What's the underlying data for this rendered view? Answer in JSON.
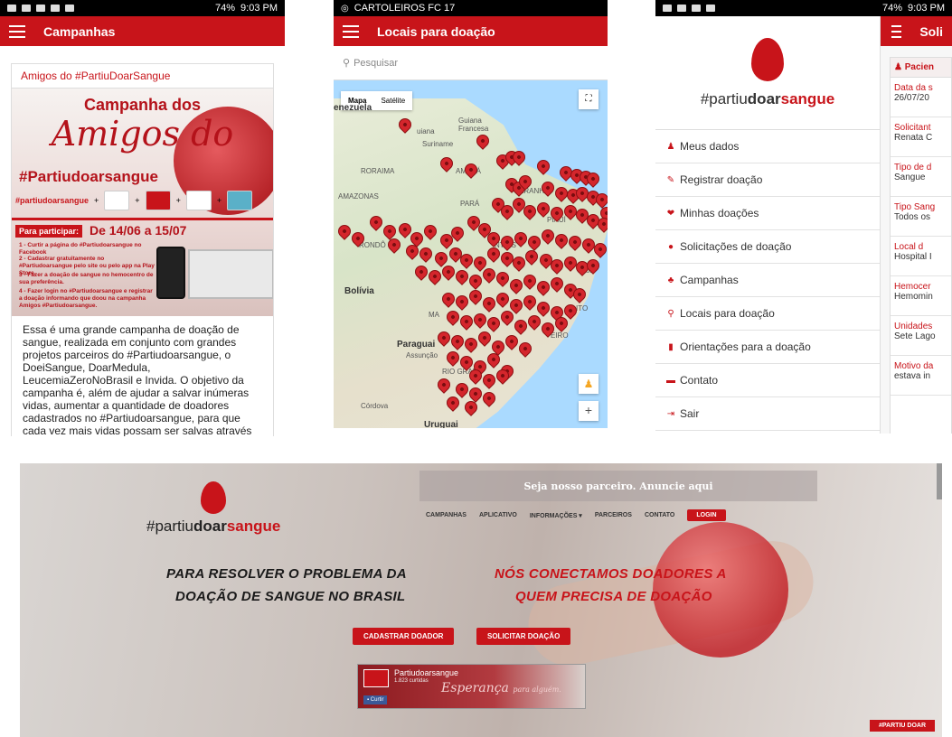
{
  "screen1": {
    "status_time": "9:03 PM",
    "status_battery": "74%",
    "appbar_title": "Campanhas",
    "card_title": "Amigos do #PartiuDoarSangue",
    "poster_line1": "Campanha dos",
    "poster_line2": "Amigos do",
    "poster_line3": "#Partiudoarsangue",
    "poster_brand": "#partiudoarsangue",
    "poster_para": "Para participar:",
    "poster_dates": "De 14/06 a 15/07",
    "poster_steps": [
      "1 - Curtir a página do #Partiudoarsangue no Facebook",
      "2 - Cadastrar gratuitamente no #Partiudoarsangue pelo site ou pelo app na Play Store.",
      "3 - Fazer a doação de sangue no hemocentro de sua preferência.",
      "4 - Fazer login no #Partiudoarsangue e registrar a doação informando que doou na campanha Amigos #Partiudoarsangue."
    ],
    "body_text": "Essa é uma grande campanha de doação de sangue, realizada em conjunto com grandes projetos parceiros do #Partiudoarsangue, o DoeiSangue, DoarMedula, LeucemiaZeroNoBrasil e Invida.  O objetivo da campanha é, além de ajudar a salvar inúmeras vidas, aumentar a quantidade de doadores cadastrados no #Partiudoarsangue, para que cada vez mais vidas possam ser salvas através da plataforma."
  },
  "screen2": {
    "status_text": "CARTOLEIROS FC 17",
    "appbar_title": "Locais para doação",
    "search_placeholder": "Pesquisar",
    "tab_map": "Mapa",
    "tab_sat": "Satélite",
    "labels": {
      "venezuela": "enezuela",
      "guiana": "uiana",
      "guiana_fr": "Guiana Francesa",
      "suriname": "Suriname",
      "roraima": "RORAIMA",
      "amapa": "AMAPÁ",
      "amazonas": "AMAZONAS",
      "para": "PARÁ",
      "maranhao": "ARANH",
      "piaui": "PIAUÍ",
      "rondonia": "RONDÔ",
      "tocantins": "NTINS",
      "bolivia": "Bolívia",
      "paraguai": "Paraguai",
      "assuncao": "Assunção",
      "cordova": "Córdova",
      "uruguai": "Uruguai",
      "rio_grande": "RIO GRAND",
      "mato": "MA",
      "bahia": "ador",
      "espirito": "ITO",
      "janeiro": "EIRO"
    }
  },
  "screen3": {
    "status_time": "9:03 PM",
    "status_battery": "74%",
    "brand_pre": "#partiu",
    "brand_mid": "doar",
    "brand_post": "sangue",
    "menu": [
      {
        "icon": "user-icon",
        "glyph": "♟",
        "label": "Meus dados"
      },
      {
        "icon": "edit-icon",
        "glyph": "✎",
        "label": "Registrar doação"
      },
      {
        "icon": "heart-icon",
        "glyph": "❤",
        "label": "Minhas doações"
      },
      {
        "icon": "drop-icon",
        "glyph": "●",
        "label": "Solicitações de doação"
      },
      {
        "icon": "users-icon",
        "glyph": "♣",
        "label": "Campanhas"
      },
      {
        "icon": "location-icon",
        "glyph": "⚲",
        "label": "Locais para doação"
      },
      {
        "icon": "book-icon",
        "glyph": "▮",
        "label": "Orientações para a doação"
      },
      {
        "icon": "card-icon",
        "glyph": "▬",
        "label": "Contato"
      },
      {
        "icon": "logout-icon",
        "glyph": "⇥",
        "label": "Sair"
      }
    ],
    "right_title": "Soli",
    "right_header": "Pacien",
    "fields": [
      {
        "k": "Data da s",
        "v": "26/07/20"
      },
      {
        "k": "Solicitant",
        "v": "Renata C"
      },
      {
        "k": "Tipo de d",
        "v": "Sangue"
      },
      {
        "k": "Tipo Sang",
        "v": "Todos os"
      },
      {
        "k": "Local d",
        "v": "Hospital I"
      },
      {
        "k": "Hemocer",
        "v": "Hemomin"
      },
      {
        "k": "Unidades",
        "v": "Sete Lago"
      },
      {
        "k": "Motivo da",
        "v": "estava in"
      }
    ]
  },
  "screen4": {
    "brand_pre": "#partiu",
    "brand_mid": "doar",
    "brand_post": "sangue",
    "partner_text": "Seja nosso parceiro. Anuncie aqui",
    "nav": [
      "CAMPANHAS",
      "APLICATIVO",
      "INFORMAÇÕES",
      "PARCEIROS",
      "CONTATO"
    ],
    "login": "LOGIN",
    "headline_left_1": "PARA RESOLVER O PROBLEMA DA",
    "headline_left_2": "DOAÇÃO DE SANGUE NO BRASIL",
    "headline_right_1": "NÓS CONECTAMOS DOADORES A",
    "headline_right_2": "QUEM PRECISA DE DOAÇÃO",
    "btn_donor": "CADASTRAR DOADOR",
    "btn_request": "SOLICITAR DOAÇÃO",
    "fb_title": "Partiudoarsangue",
    "fb_count": "1.823 curtidas",
    "fb_like": "Curtir",
    "fb_slogan": "Esperança",
    "fb_slogan2": "para alguém.",
    "tag": "#PARTIU DOAR"
  }
}
